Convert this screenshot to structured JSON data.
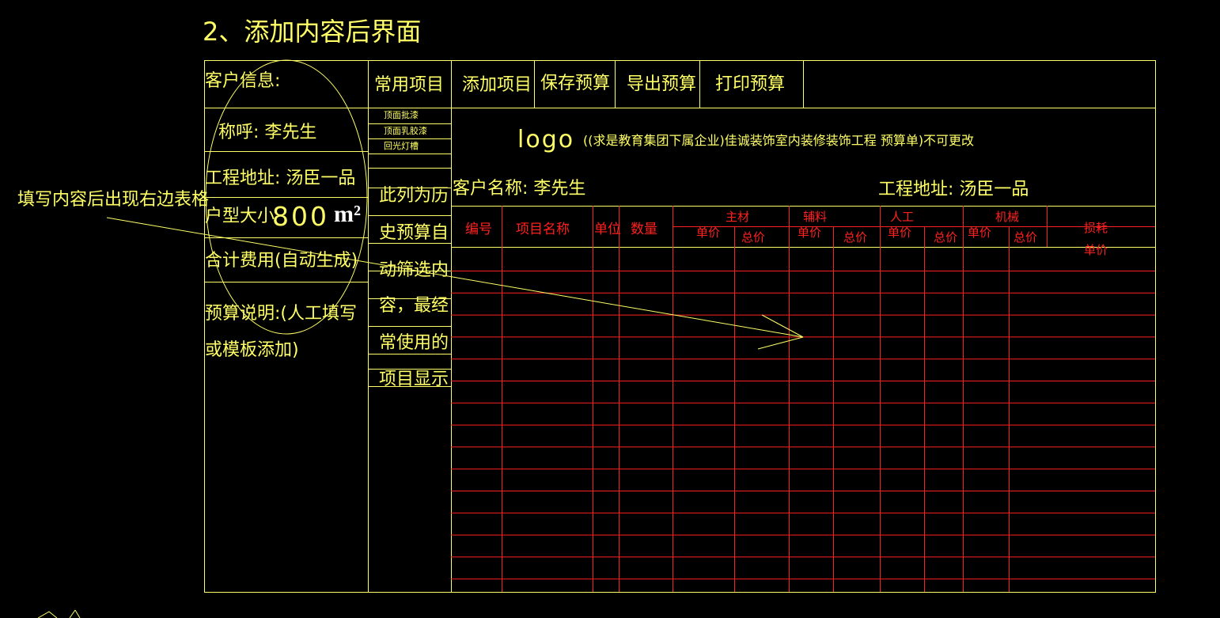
{
  "title": "2、添加内容后界面",
  "left_panel": {
    "customer_info": "客户信息:",
    "salutation": "称呼: 李先生",
    "address": "工程地址: 汤臣一品",
    "area_label": "户型大小",
    "area_value": "800",
    "area_unit": "m²",
    "total_cost": "合计费用(自动生成)",
    "budget_note_1": "预算说明:(人工填写",
    "budget_note_2": "或模板添加)"
  },
  "middle_column": {
    "header": "常用项目",
    "items": [
      "顶面批漆",
      "顶面乳胶漆",
      "回光灯槽"
    ],
    "note_lines": [
      "此列为历",
      "史预算自",
      "动筛选内",
      "容，最经",
      "常使用的",
      "项目显示"
    ]
  },
  "toolbar": {
    "add": "添加项目",
    "save": "保存预算",
    "export": "导出预算",
    "print": "打印预算"
  },
  "banner": {
    "logo": "logo",
    "text": "((求是教育集团下属企业)佳诚装饰室内装修装饰工程   预算单)不可更改"
  },
  "info_row": {
    "customer_name": "客户名称: 李先生",
    "address": "工程地址: 汤臣一品"
  },
  "table_headers": {
    "number": "编号",
    "item_name": "项目名称",
    "unit": "单位",
    "quantity": "数量",
    "main_material": "主材",
    "aux_material": "辅料",
    "labor": "人工",
    "machinery": "机械",
    "unit_price": "单价",
    "total_price": "总价",
    "loss": "损耗",
    "loss_unit_price": "单价"
  },
  "annotation": {
    "text": "填写内容后出现右边表格"
  },
  "colors": {
    "line_yellow": "#ffff66",
    "grid_red": "#ff2020",
    "background": "#000000"
  }
}
